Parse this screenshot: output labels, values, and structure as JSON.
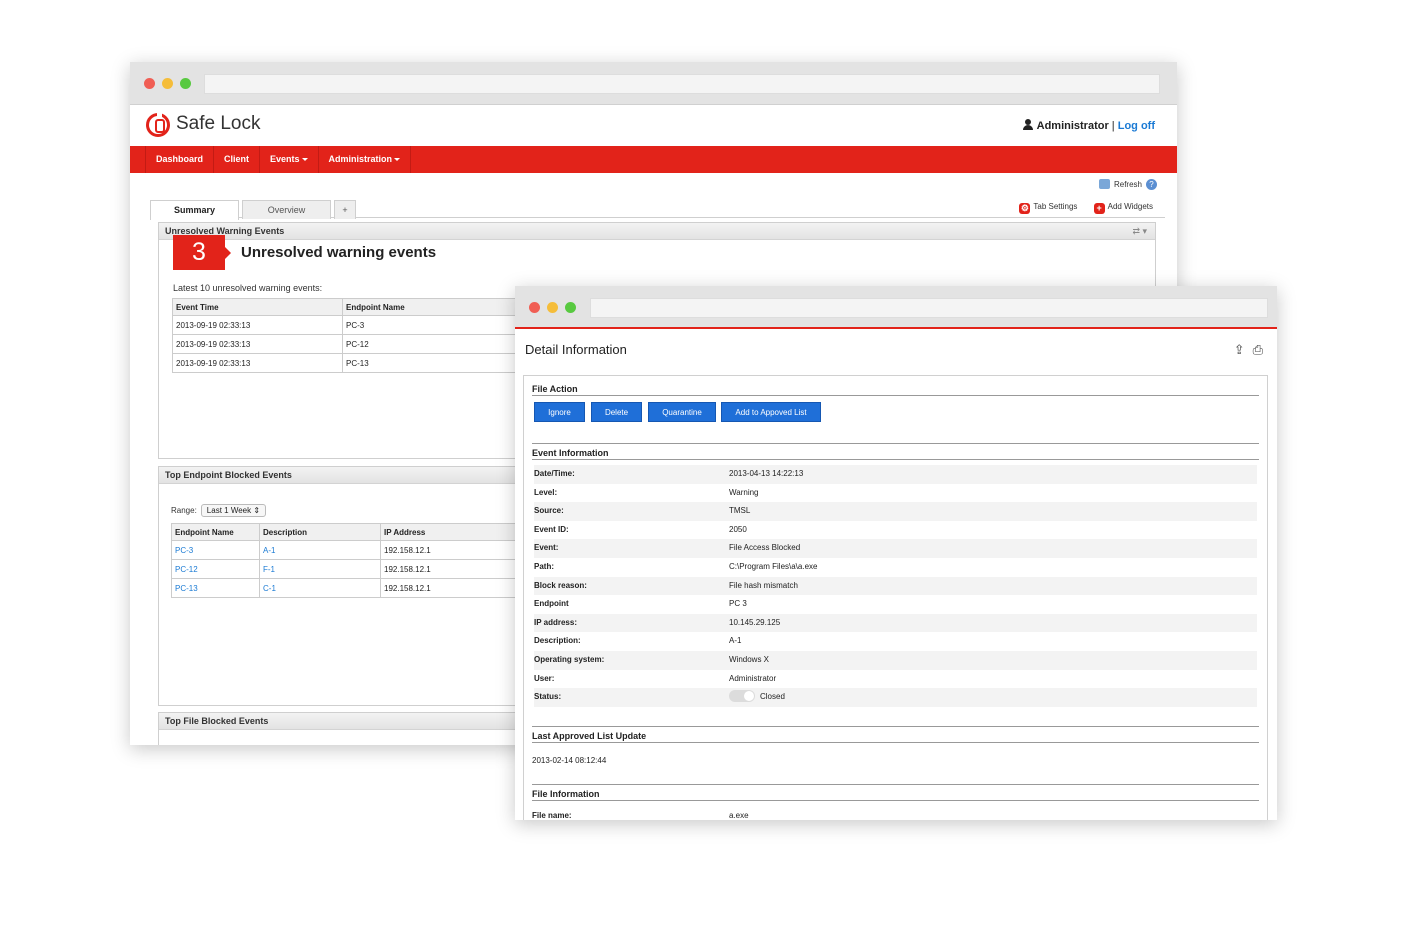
{
  "main": {
    "brand": "Safe Lock",
    "user": {
      "name": "Administrator",
      "separator": " | ",
      "logoff": "Log off"
    },
    "nav": [
      {
        "label": "Dashboard"
      },
      {
        "label": "Client"
      },
      {
        "label": "Events"
      },
      {
        "label": "Administration"
      }
    ],
    "refresh_label": "Refresh",
    "tabs": {
      "summary": "Summary",
      "overview": "Overview",
      "add": "+"
    },
    "tab_tools": {
      "settings": "Tab Settings",
      "add_widgets": "Add Widgets"
    },
    "warning_panel": {
      "header": "Unresolved Warning Events",
      "count": "3",
      "title": "Unresolved warning events",
      "latest_label": "Latest 10 unresolved warning events:",
      "columns": [
        "Event Time",
        "Endpoint Name"
      ],
      "rows": [
        [
          "2013-09-19 02:33:13",
          "PC-3"
        ],
        [
          "2013-09-19 02:33:13",
          "PC-12"
        ],
        [
          "2013-09-19 02:33:13",
          "PC-13"
        ]
      ]
    },
    "blocked_panel": {
      "header": "Top Endpoint Blocked Events",
      "range_label": "Range:",
      "range_value": "Last 1 Week",
      "columns": [
        "Endpoint Name",
        "Description",
        "IP Address"
      ],
      "rows": [
        [
          "PC-3",
          "A-1",
          "192.158.12.1"
        ],
        [
          "PC-12",
          "F-1",
          "192.158.12.1"
        ],
        [
          "PC-13",
          "C-1",
          "192.158.12.1"
        ]
      ]
    },
    "file_panel": {
      "header": "Top File Blocked Events"
    }
  },
  "detail": {
    "title": "Detail Information",
    "file_action": {
      "heading": "File Action",
      "buttons": [
        "Ignore",
        "Delete",
        "Quarantine",
        "Add to Appoved List"
      ]
    },
    "event_info": {
      "heading": "Event Information",
      "rows": [
        {
          "key": "Date/Time:",
          "value": "2013-04-13 14:22:13"
        },
        {
          "key": "Level:",
          "value": "Warning"
        },
        {
          "key": "Source:",
          "value": "TMSL"
        },
        {
          "key": "Event ID:",
          "value": "2050"
        },
        {
          "key": "Event:",
          "value": "File Access Blocked"
        },
        {
          "key": "Path:",
          "value": "C:\\Program Files\\a\\a.exe"
        },
        {
          "key": "Block reason:",
          "value": "File hash mismatch"
        },
        {
          "key": "Endpoint",
          "value": "PC 3"
        },
        {
          "key": "IP address:",
          "value": "10.145.29.125"
        },
        {
          "key": "Description:",
          "value": "A-1"
        },
        {
          "key": "Operating system:",
          "value": "Windows X"
        },
        {
          "key": "User:",
          "value": "Administrator"
        },
        {
          "key": "Status:",
          "value": "Closed"
        }
      ]
    },
    "last_update": {
      "heading": "Last Approved List Update",
      "value": "2013-02-14 08:12:44"
    },
    "file_info": {
      "heading": "File Information",
      "key": "File name:",
      "value": "a.exe"
    }
  }
}
